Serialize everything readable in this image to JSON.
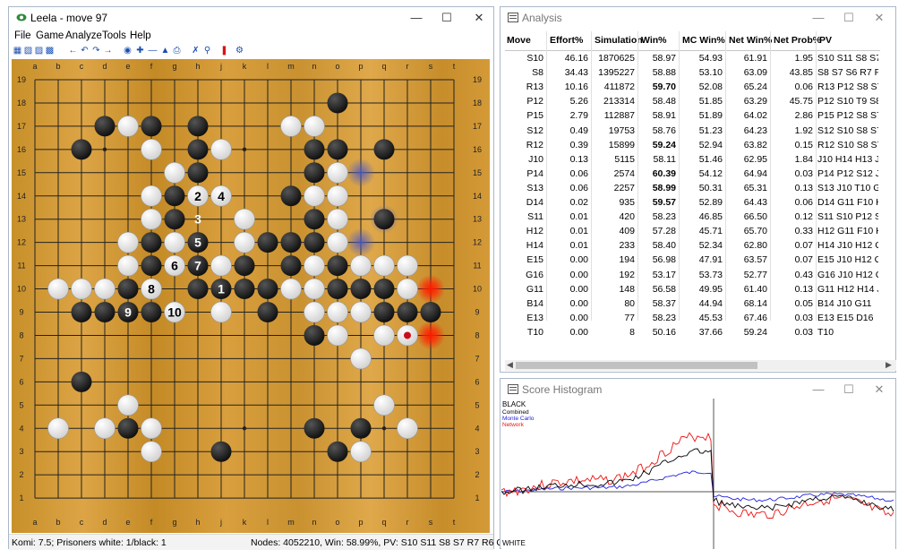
{
  "main_window": {
    "title": "Leela - move 97",
    "menu": [
      "File",
      "Game",
      "Analyze",
      "Tools",
      "Help"
    ],
    "toolbar_icons": [
      "new-game-icon",
      "open-file-icon",
      "open-folder-icon",
      "save-icon",
      "back-icon",
      "undo-icon",
      "redo-icon",
      "forward-icon",
      "analyze-icon",
      "add-move-icon",
      "remove-move-icon",
      "score-icon",
      "print-icon",
      "cut-icon",
      "find-icon",
      "flag-icon",
      "settings-icon"
    ],
    "status_left": "Komi: 7.5; Prisoners white: 1/black: 1",
    "status_right": "Nodes: 4052210, Win: 58.99%, PV: S10 S11 S8 S7 R7 R6 O7 N7 M"
  },
  "board": {
    "columns": [
      "a",
      "b",
      "c",
      "d",
      "e",
      "f",
      "g",
      "h",
      "j",
      "k",
      "l",
      "m",
      "n",
      "o",
      "p",
      "q",
      "r",
      "s",
      "t"
    ],
    "rows": [
      "19",
      "18",
      "17",
      "16",
      "15",
      "14",
      "13",
      "12",
      "11",
      "10",
      "9",
      "8",
      "7",
      "6",
      "5",
      "4",
      "3",
      "2",
      "1"
    ],
    "black_stones": [
      "O18",
      "D17",
      "F17",
      "H17",
      "C16",
      "F16",
      "H16",
      "N16",
      "O16",
      "Q16",
      "H15",
      "N15",
      "G14",
      "M14",
      "G13",
      "N13",
      "Q13",
      "F12",
      "H12",
      "L12",
      "M12",
      "N12",
      "F11",
      "H11",
      "K11",
      "M11",
      "O11",
      "E10",
      "H10",
      "J10",
      "K10",
      "L10",
      "O10",
      "P10",
      "Q10",
      "C9",
      "D9",
      "E9",
      "F9",
      "L9",
      "Q9",
      "R9",
      "S9",
      "N8",
      "C6",
      "E4",
      "N4",
      "P4",
      "J3",
      "O3"
    ],
    "white_stones": [
      "E17",
      "M17",
      "N17",
      "F16",
      "J16",
      "G15",
      "O15",
      "F14",
      "H14",
      "J14",
      "N14",
      "O14",
      "F13",
      "K13",
      "O13",
      "E12",
      "G12",
      "K12",
      "O12",
      "E11",
      "G11",
      "J11",
      "N11",
      "P11",
      "Q11",
      "R11",
      "B10",
      "C10",
      "D10",
      "F10",
      "M10",
      "N10",
      "R10",
      "J9",
      "N9",
      "O9",
      "P9",
      "G9",
      "O8",
      "Q8",
      "R8",
      "P7",
      "E5",
      "Q5",
      "B4",
      "D4",
      "F4",
      "R4",
      "F3",
      "P3"
    ],
    "numbered": [
      {
        "pt": "H14",
        "n": "2",
        "color": "white"
      },
      {
        "pt": "J14",
        "n": "4",
        "color": "white"
      },
      {
        "pt": "H13",
        "n": "3",
        "color": "black"
      },
      {
        "pt": "H12",
        "n": "5",
        "color": "black"
      },
      {
        "pt": "G11",
        "n": "6",
        "color": "white"
      },
      {
        "pt": "H11",
        "n": "7",
        "color": "black"
      },
      {
        "pt": "F10",
        "n": "8",
        "color": "white"
      },
      {
        "pt": "J10",
        "n": "1",
        "color": "black"
      },
      {
        "pt": "E9",
        "n": "9",
        "color": "black"
      },
      {
        "pt": "G9",
        "n": "10",
        "color": "white"
      }
    ],
    "last_move": "R8",
    "heat_red": [
      "S10",
      "S8"
    ],
    "heat_blue": [
      "P15",
      "Q13",
      "P12"
    ]
  },
  "analysis": {
    "title": "Analysis",
    "columns": [
      "Move",
      "Effort%",
      "Simulation",
      "Win%",
      "MC Win%",
      "Net Win%",
      "Net Prob%",
      "PV"
    ],
    "rows": [
      [
        "S10",
        "46.16",
        "1870625",
        "58.97",
        "54.93",
        "61.91",
        "1.95",
        "S10 S11 S8 S7 R7 R6"
      ],
      [
        "S8",
        "34.43",
        "1395227",
        "58.88",
        "53.10",
        "63.09",
        "43.85",
        "S8 S7 S6 R7 P12 S10"
      ],
      [
        "R13",
        "10.16",
        "411872",
        "59.70",
        "52.08",
        "65.24",
        "0.06",
        "R13 P12 S8 S7 R7 R6"
      ],
      [
        "P12",
        "5.26",
        "213314",
        "58.48",
        "51.85",
        "63.29",
        "45.75",
        "P12 S10 T9 S8 P14 T"
      ],
      [
        "P15",
        "2.79",
        "112887",
        "58.91",
        "51.89",
        "64.02",
        "2.86",
        "P15 P12 S8 S7 R7 R6"
      ],
      [
        "S12",
        "0.49",
        "19753",
        "58.76",
        "51.23",
        "64.23",
        "1.92",
        "S12 S10 S8 S7 R7 T8"
      ],
      [
        "R12",
        "0.39",
        "15899",
        "59.24",
        "52.94",
        "63.82",
        "0.15",
        "R12 S10 S8 S7 J10 H"
      ],
      [
        "J10",
        "0.13",
        "5115",
        "58.11",
        "51.46",
        "62.95",
        "1.84",
        "J10 H14 H13 J14 H12"
      ],
      [
        "P14",
        "0.06",
        "2574",
        "60.39",
        "54.12",
        "64.94",
        "0.03",
        "P14 P12 S12 J10 H12"
      ],
      [
        "S13",
        "0.06",
        "2257",
        "58.99",
        "50.31",
        "65.31",
        "0.13",
        "S13 J10 T10 G11 F10"
      ],
      [
        "D14",
        "0.02",
        "935",
        "59.57",
        "52.89",
        "64.43",
        "0.06",
        "D14 G11 F10 H14 H1"
      ],
      [
        "S11",
        "0.01",
        "420",
        "58.23",
        "46.85",
        "66.50",
        "0.12",
        "S11 S10 P12 S8 R12"
      ],
      [
        "H12",
        "0.01",
        "409",
        "57.28",
        "45.71",
        "65.70",
        "0.33",
        "H12 G11 F10 H11 J1"
      ],
      [
        "H14",
        "0.01",
        "233",
        "58.40",
        "52.34",
        "62.80",
        "0.07",
        "H14 J10 H12 G11 F1"
      ],
      [
        "E15",
        "0.00",
        "194",
        "56.98",
        "47.91",
        "63.57",
        "0.07",
        "E15 J10 H12 G11 F10"
      ],
      [
        "G16",
        "0.00",
        "192",
        "53.17",
        "53.73",
        "52.77",
        "0.43",
        "G16 J10 H12 G11 F10"
      ],
      [
        "G11",
        "0.00",
        "148",
        "56.58",
        "49.95",
        "61.40",
        "0.13",
        "G11 H12 H14 J10 H1"
      ],
      [
        "B14",
        "0.00",
        "80",
        "58.37",
        "44.94",
        "68.14",
        "0.05",
        "B14 J10 G11"
      ],
      [
        "E13",
        "0.00",
        "77",
        "58.23",
        "45.53",
        "67.46",
        "0.03",
        "E13 E15 D16"
      ],
      [
        "T10",
        "0.00",
        "8",
        "50.16",
        "37.66",
        "59.24",
        "0.03",
        "T10"
      ]
    ],
    "bold_win": [
      "59.70",
      "59.24",
      "60.39",
      "58.99",
      "59.57"
    ]
  },
  "histogram": {
    "title": "Score Histogram",
    "label_top": "BLACK",
    "label_bottom": "WHITE",
    "legend": [
      {
        "name": "Combined",
        "color": "#000000"
      },
      {
        "name": "Monte Carlo",
        "color": "#2222dd"
      },
      {
        "name": "Network",
        "color": "#ee1111"
      }
    ]
  }
}
